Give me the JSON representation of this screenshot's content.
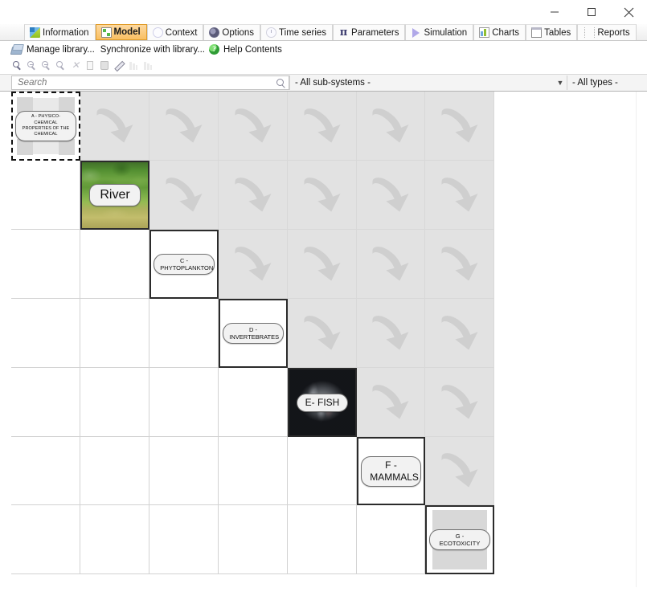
{
  "window": {
    "minimize_label": "minimize",
    "maximize_label": "maximize",
    "close_label": "close"
  },
  "tabs": [
    {
      "label": "Information",
      "icon": "information-icon",
      "active": false
    },
    {
      "label": "Model",
      "icon": "model-icon",
      "active": true
    },
    {
      "label": "Context",
      "icon": "context-icon",
      "active": false
    },
    {
      "label": "Options",
      "icon": "options-icon",
      "active": false
    },
    {
      "label": "Time series",
      "icon": "time-series-icon",
      "active": false
    },
    {
      "label": "Parameters",
      "icon": "parameters-icon",
      "active": false
    },
    {
      "label": "Simulation",
      "icon": "simulation-icon",
      "active": false
    },
    {
      "label": "Charts",
      "icon": "charts-icon",
      "active": false
    },
    {
      "label": "Tables",
      "icon": "tables-icon",
      "active": false
    },
    {
      "label": "Reports",
      "icon": "reports-icon",
      "active": false
    }
  ],
  "linkbar": {
    "manage_library": "Manage library...",
    "synchronize_with_library": "Synchronize with library...",
    "help_contents": "Help Contents",
    "library_icon": "library-icon",
    "help_icon": "help-icon"
  },
  "toolbar": {
    "buttons": [
      {
        "name": "zoom-selection-icon",
        "state": "enabled"
      },
      {
        "name": "zoom-in-icon",
        "state": "disabled"
      },
      {
        "name": "zoom-out-icon",
        "state": "disabled"
      },
      {
        "name": "zoom-reset-icon",
        "state": "disabled"
      },
      {
        "name": "delete-icon",
        "state": "disabled"
      },
      {
        "name": "copy-icon",
        "state": "disabled"
      },
      {
        "name": "trash-icon",
        "state": "disabled"
      },
      {
        "name": "edit-pencil-icon",
        "state": "disabled"
      },
      {
        "name": "align-left-icon",
        "state": "dim"
      },
      {
        "name": "distribute-icon",
        "state": "dim"
      }
    ]
  },
  "filters": {
    "search_placeholder": "Search",
    "search_value": "",
    "search_icon": "search-icon",
    "subsystems_selected": "- All sub-systems -",
    "types_selected": "- All types -"
  },
  "matrix": {
    "columns": 7,
    "rows": 7,
    "arrow_icon": "curved-arrow-down-right-icon",
    "upper_cell_color": "#e2e2e2",
    "grid_line_color": "#d2d2d2",
    "nodes": [
      {
        "id": "A",
        "label": "A - PHYSICO-CHEMICAL PROPERTIES OF THE CHEMICAL",
        "row": 0,
        "col": 0,
        "selected": true,
        "style": "selected-handles",
        "text_size": "tiny"
      },
      {
        "id": "B",
        "label": "River",
        "row": 1,
        "col": 1,
        "selected": false,
        "style": "photo-river",
        "text_size": "big"
      },
      {
        "id": "C",
        "label": "C - PHYTOPLANKTON",
        "row": 2,
        "col": 2,
        "selected": false,
        "style": "plain",
        "text_size": "sm"
      },
      {
        "id": "D",
        "label": "D - INVERTEBRATES",
        "row": 3,
        "col": 3,
        "selected": false,
        "style": "plain",
        "text_size": "sm"
      },
      {
        "id": "E",
        "label": "E- FISH",
        "row": 4,
        "col": 4,
        "selected": false,
        "style": "photo-fish",
        "text_size": "med"
      },
      {
        "id": "F",
        "label": "F - MAMMALS",
        "row": 5,
        "col": 5,
        "selected": false,
        "style": "plain",
        "text_size": "med"
      },
      {
        "id": "G",
        "label": "G - ECOTOXICITY",
        "row": 6,
        "col": 6,
        "selected": false,
        "style": "gray-inner",
        "text_size": "sm"
      }
    ]
  }
}
